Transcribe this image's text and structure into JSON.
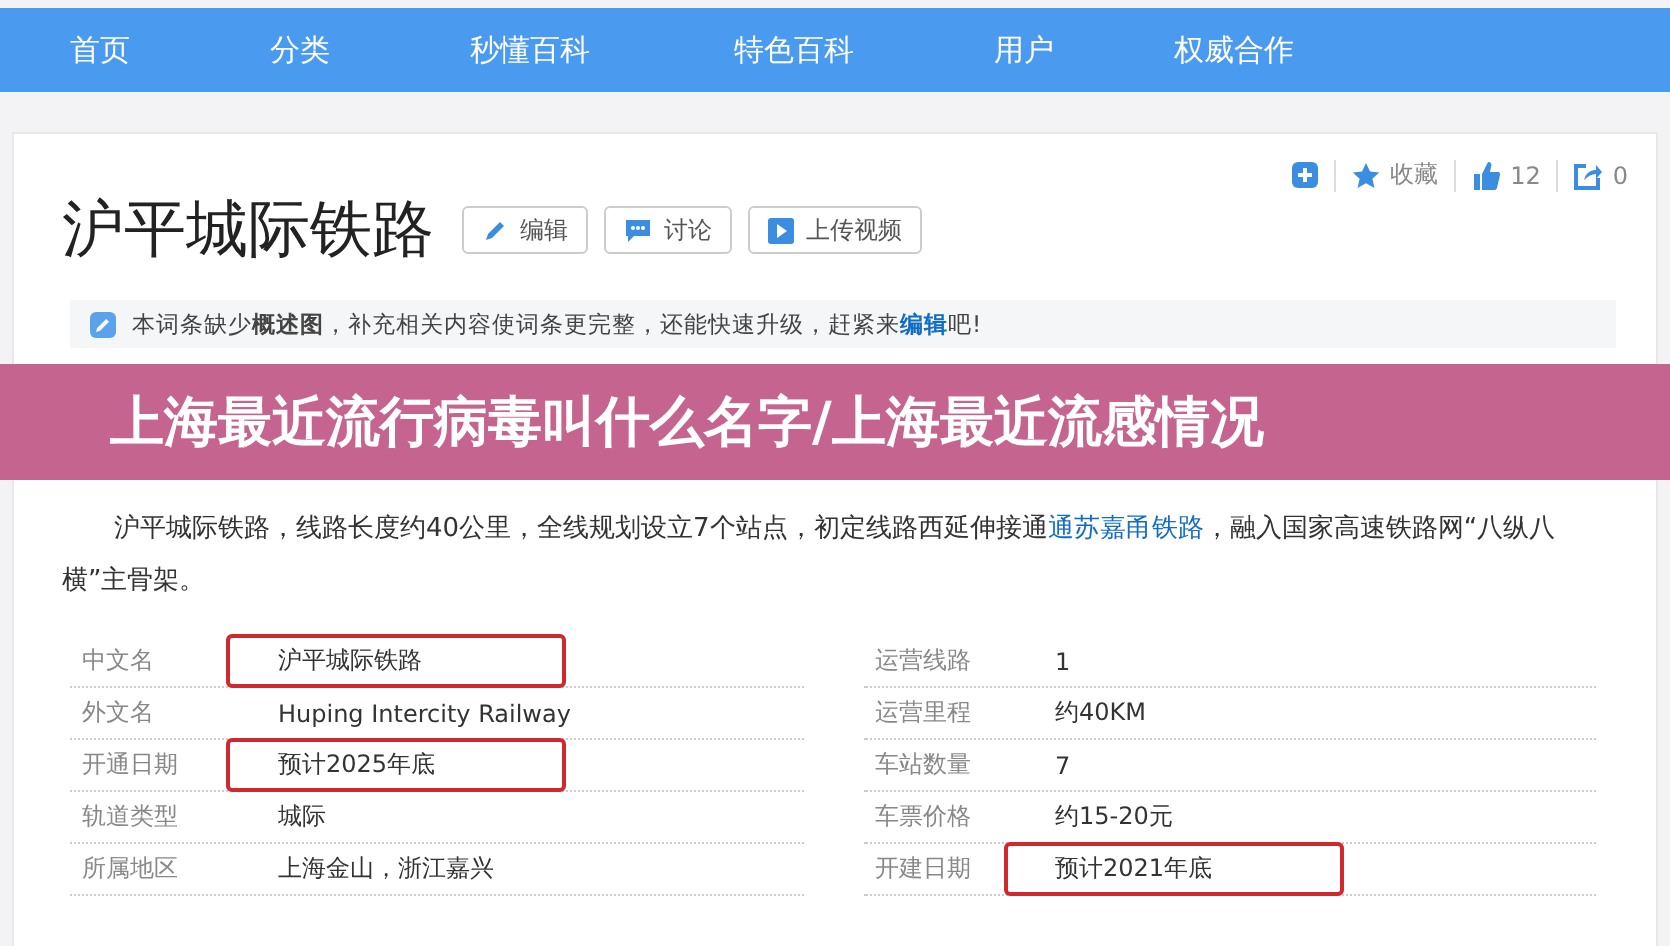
{
  "nav": {
    "items": [
      {
        "label": "首页"
      },
      {
        "label": "分类"
      },
      {
        "label": "秒懂百科"
      },
      {
        "label": "特色百科"
      },
      {
        "label": "用户"
      },
      {
        "label": "权威合作"
      }
    ]
  },
  "actions": {
    "favorite": "收藏",
    "likes": "12",
    "shares": "0"
  },
  "title": "沪平城际铁路",
  "title_buttons": [
    {
      "kind": "edit",
      "label": "编辑"
    },
    {
      "kind": "discuss",
      "label": "讨论"
    },
    {
      "kind": "video",
      "label": "上传视频"
    }
  ],
  "notice": {
    "text": "本词条缺少**概述图**，补充相关内容使词条更完整，还能快速升级，赶紧来",
    "link": "编辑",
    "tail": "吧!"
  },
  "banner": "上海最近流行病毒叫什么名字/上海最近流感情况",
  "paragraph": {
    "text": "沪平城际铁路，线路长度约40公里，全线规划设立7个站点，初定线路西延伸接通",
    "link": "通苏嘉甬铁路",
    "tail": "，融入国家高速铁路网“八纵八横”主骨架。"
  },
  "info_table": {
    "rows": [
      {
        "left": {
          "label": "中文名",
          "value": "沪平城际铁路",
          "highlighted": true
        },
        "right": {
          "label": "运营线路",
          "value": "1",
          "highlighted": false
        }
      },
      {
        "left": {
          "label": "外文名",
          "value": "Huping Intercity Railway",
          "highlighted": false
        },
        "right": {
          "label": "运营里程",
          "value": "约40KM",
          "highlighted": false
        }
      },
      {
        "left": {
          "label": "开通日期",
          "value": "预计2025年底",
          "highlighted": true
        },
        "right": {
          "label": "车站数量",
          "value": "7",
          "highlighted": false
        }
      },
      {
        "left": {
          "label": "轨道类型",
          "value": "城际",
          "highlighted": false
        },
        "right": {
          "label": "车票价格",
          "value": "约15-20元",
          "highlighted": false
        }
      },
      {
        "left": {
          "label": "所属地区",
          "value": "上海金山，浙江嘉兴",
          "highlighted": false
        },
        "right": {
          "label": "开建日期",
          "value": "预计2021年底",
          "highlighted": true
        }
      }
    ]
  }
}
